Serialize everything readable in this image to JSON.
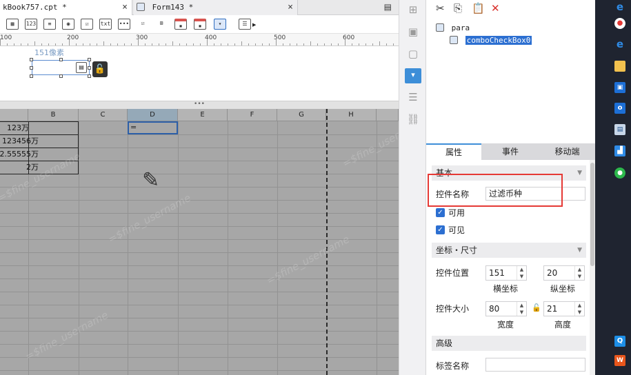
{
  "tabs": [
    {
      "label": "kBook757.cpt *",
      "close": "×"
    },
    {
      "label": "Form143 *",
      "close": "×"
    }
  ],
  "toolbar": {
    "icons": [
      "table-icon",
      "number-field-icon",
      "text-area-icon",
      "radio-group-icon",
      "checkbox-group-icon",
      "text-field-icon",
      "password-icon",
      "checkbox-icon",
      "tree-icon",
      "date-icon",
      "datetime-icon",
      "combo-box-icon",
      "more-icon"
    ],
    "icon_text": {
      "number": "123",
      "text": "txt"
    }
  },
  "ruler": {
    "labels": [
      "100",
      "200",
      "300",
      "400",
      "500",
      "600"
    ]
  },
  "widget": {
    "size_label": "151像素"
  },
  "grid": {
    "columns": [
      "B",
      "C",
      "D",
      "E",
      "F",
      "G",
      "H"
    ],
    "cells": [
      "123万",
      "123456万",
      "2.55555万",
      "2万"
    ],
    "selected_value": "="
  },
  "watermark": "=$fine_username",
  "tree": {
    "root": "para",
    "child": "comboCheckBox0"
  },
  "panel_tabs": [
    "属性",
    "事件",
    "移动端"
  ],
  "props": {
    "section_basic": "基本",
    "name_label": "控件名称",
    "name_value": "过滤币种",
    "enabled_label": "可用",
    "visible_label": "可见",
    "section_coords": "坐标・尺寸",
    "position_label": "控件位置",
    "pos_x": "151",
    "pos_y": "20",
    "pos_x_label": "横坐标",
    "pos_y_label": "纵坐标",
    "size_label": "控件大小",
    "width": "80",
    "height": "21",
    "width_label": "宽度",
    "height_label": "高度",
    "section_advanced": "高级",
    "tag_name_label": "标签名称",
    "tag_name_value": ""
  },
  "colors": {
    "accent": "#3d8ed8",
    "highlight": "#e53935",
    "selection": "#2c6fd1"
  }
}
